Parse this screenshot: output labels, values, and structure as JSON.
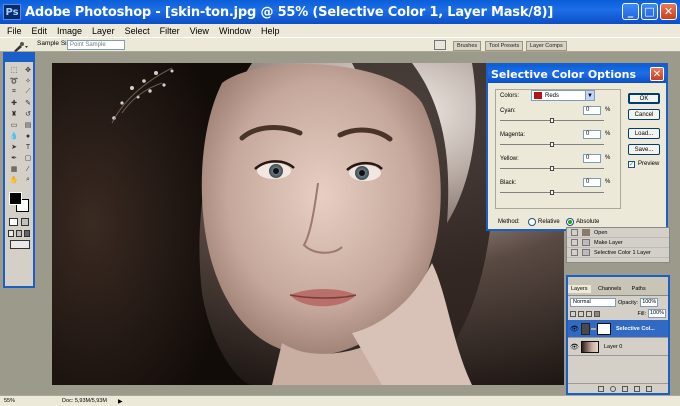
{
  "window": {
    "title": "Adobe Photoshop - [skin-ton.jpg @ 55% (Selective Color 1, Layer Mask/8)]",
    "app_icon": "Ps",
    "controls": [
      "_",
      "□",
      "✕"
    ]
  },
  "menu": [
    "File",
    "Edit",
    "Image",
    "Layer",
    "Select",
    "Filter",
    "View",
    "Window",
    "Help"
  ],
  "options_bar": {
    "sample_size_label": "Sample Size:",
    "sample_size_value": "Point Sample"
  },
  "workspace_tabs": [
    "Brushes",
    "Tool Presets",
    "Layer Comps"
  ],
  "dialog": {
    "title": "Selective Color Options",
    "colors_label": "Colors:",
    "colors_value": "Reds",
    "colors_swatch": "#b01818",
    "adjustments": [
      {
        "label": "Cyan:",
        "value": "0",
        "unit": "%"
      },
      {
        "label": "Magenta:",
        "value": "0",
        "unit": "%"
      },
      {
        "label": "Yellow:",
        "value": "0",
        "unit": "%"
      },
      {
        "label": "Black:",
        "value": "0",
        "unit": "%"
      }
    ],
    "method_label": "Method:",
    "method_options": [
      "Relative",
      "Absolute"
    ],
    "method_selected": "Absolute",
    "buttons": [
      "OK",
      "Cancel",
      "Load...",
      "Save..."
    ],
    "preview_label": "Preview",
    "preview_checked": true
  },
  "history": {
    "items": [
      "Open",
      "Make Layer",
      "Selective Color 1 Layer"
    ]
  },
  "layers": {
    "tabs": [
      "Layers",
      "Channels",
      "Paths"
    ],
    "blend_mode": "Normal",
    "opacity_label": "Opacity:",
    "opacity_value": "100%",
    "fill_label": "Fill:",
    "fill_value": "100%",
    "items": [
      {
        "name": "Selective Col...",
        "selected": true
      },
      {
        "name": "Layer 0",
        "selected": false
      }
    ]
  },
  "status": {
    "zoom": "55%",
    "doc": "Doc: 5,93M/5,93M"
  },
  "colors": {
    "xp_blue": "#1a5fc8",
    "selection": "#316ac5"
  }
}
